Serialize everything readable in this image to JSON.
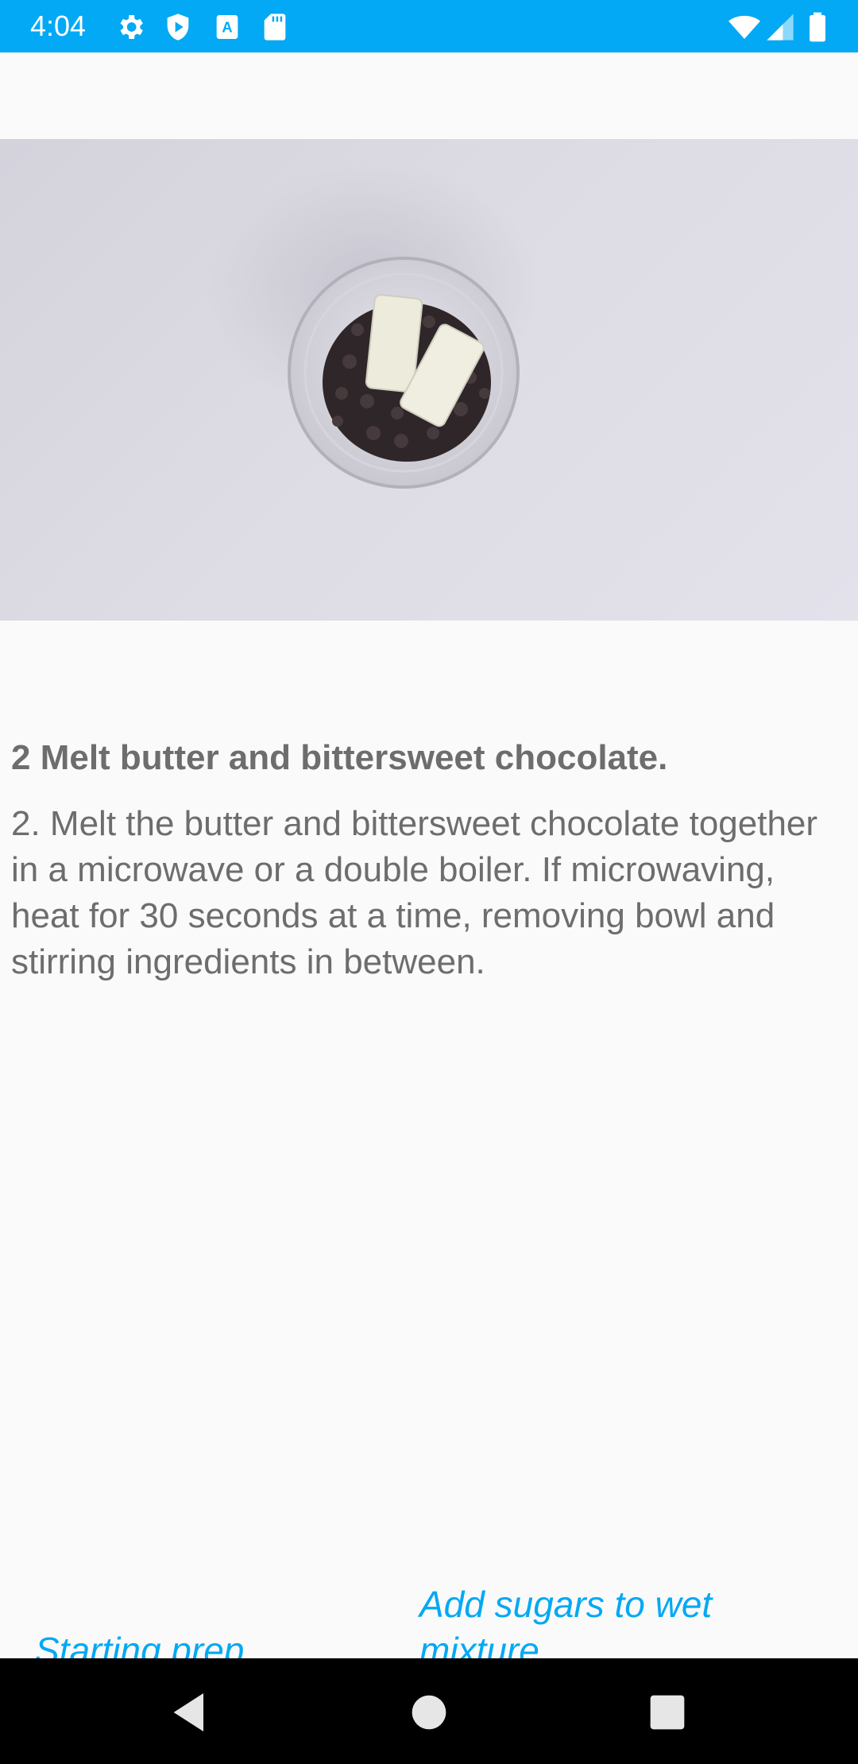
{
  "status_bar": {
    "time": "4:04",
    "icons_left": [
      "gear-icon",
      "shield-play-icon",
      "a-icon",
      "sd-card-icon"
    ],
    "icons_right": [
      "wifi-icon",
      "signal-icon",
      "battery-icon"
    ],
    "color": "#03a9f4"
  },
  "step": {
    "title": "2 Melt butter and bittersweet chocolate.",
    "description": "2. Melt the butter and bittersweet chocolate together in a microwave or a double boiler. If microwaving, heat for 30 seconds at a time, removing bowl and stirring ingredients in between.",
    "video_url": "https://d17h27t6h515a5.cloudfront.net/topher/2017/April/58ffdc43_1-melt-choclate-chips-and-butter-brownies/1-melt-choclate-chips-and-butter-brownies.mp4"
  },
  "navigation": {
    "previous_label": "Starting prep",
    "next_label": "Add sugars to wet mixture."
  },
  "colors": {
    "accent": "#03a9f4",
    "text": "#6d6d6d",
    "background": "#fafafa"
  }
}
